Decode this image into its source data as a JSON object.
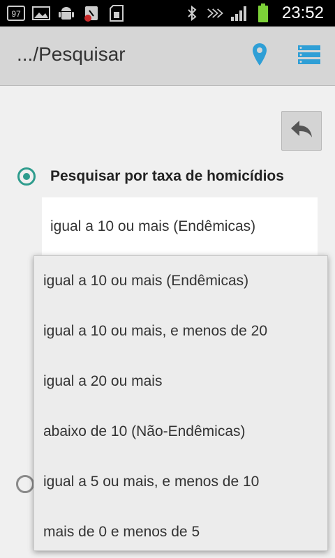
{
  "statusbar": {
    "time": "23:52",
    "left_icons": [
      "sim-97-icon",
      "image-icon",
      "android-icon",
      "sync-alert-icon",
      "sd-card-icon"
    ],
    "right_icons": [
      "bluetooth-icon",
      "network-activity-icon",
      "signal-icon",
      "battery-icon"
    ],
    "sim_label": "97"
  },
  "actionbar": {
    "title": ".../Pesquisar"
  },
  "colors": {
    "accent": "#2e9c8d",
    "action_icon": "#2f9fd6"
  },
  "form": {
    "radio_homicidios_label": "Pesquisar por taxa de homicídios",
    "spinner_value": "igual a 10 ou mais (Endêmicas)"
  },
  "dropdown": {
    "options": [
      "igual a 10 ou mais (Endêmicas)",
      "igual a 10 ou mais, e menos de 20",
      "igual a 20 ou mais",
      "abaixo de 10 (Não-Endêmicas)",
      "igual a 5 ou mais, e menos de 10",
      "mais de 0 e menos de 5"
    ]
  }
}
